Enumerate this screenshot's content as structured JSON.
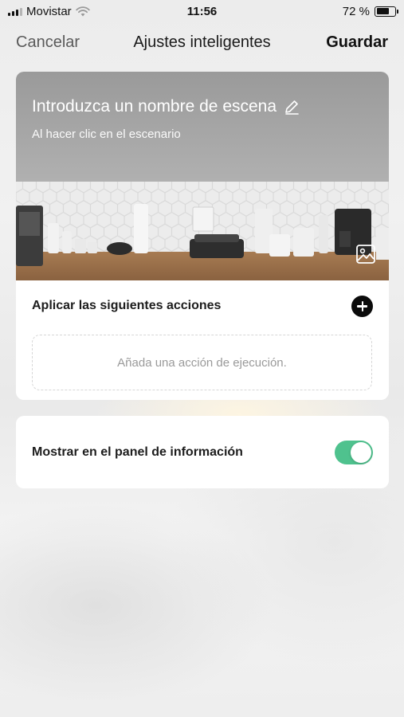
{
  "status_bar": {
    "carrier": "Movistar",
    "time": "11:56",
    "battery_text": "72 %",
    "battery_level": 0.72,
    "icons": [
      "signal-icon",
      "wifi-icon",
      "battery-icon"
    ]
  },
  "nav": {
    "cancel_label": "Cancelar",
    "title": "Ajustes inteligentes",
    "save_label": "Guardar"
  },
  "scene": {
    "name_placeholder": "Introduzca un nombre de escena",
    "subtitle": "Al hacer clic en el escenario",
    "edit_icon": "pencil-icon",
    "image_icon": "image-icon"
  },
  "actions": {
    "title": "Aplicar las siguientes acciones",
    "add_icon": "plus-circle-icon",
    "placeholder": "Añada una acción de ejecución."
  },
  "panel": {
    "label": "Mostrar en el panel de información",
    "toggle_on": true,
    "accent_color": "#4fc28e"
  }
}
